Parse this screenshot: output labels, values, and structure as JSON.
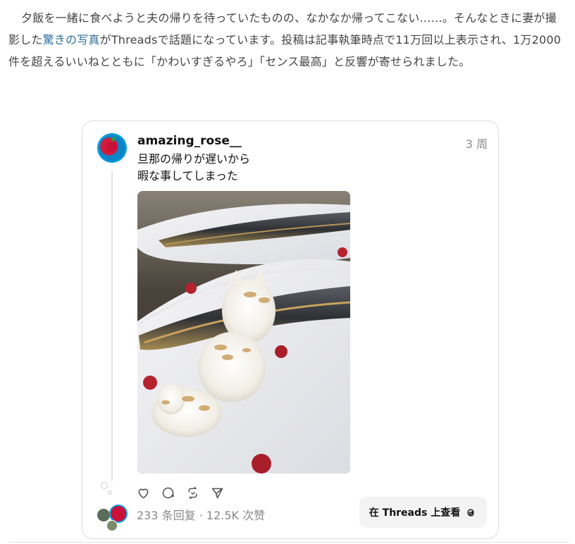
{
  "article": {
    "text_before_link": "夕飯を一緒に食べようと夫の帰りを待っていたものの、なかなか帰ってこない……。そんなときに妻が撮影した",
    "link_text": "驚きの写真",
    "text_after_link": "がThreadsで話題になっています。投稿は記事執筆時点で11万回以上表示され、1万2000件を超えるいいねとともに「かわいすぎるやろ」「センス最高」と反響が寄せられました。",
    "link_color": "#2f6f9f"
  },
  "post": {
    "username": "amazing_rose__",
    "time": "3 周",
    "text_line1": "旦那の帰りが遅いから",
    "text_line2": "暇な事してしまった",
    "photo_description_icon": "grilled-saury-with-grated-radish-cat-photo",
    "actions": {
      "like_icon": "heart-icon",
      "comment_icon": "comment-icon",
      "repost_icon": "repost-icon",
      "share_icon": "share-icon"
    },
    "stats": "233 条回复 · 12.5K 次赞",
    "view_button_label": "在 Threads 上查看",
    "view_button_icon": "threads-logo-icon"
  }
}
